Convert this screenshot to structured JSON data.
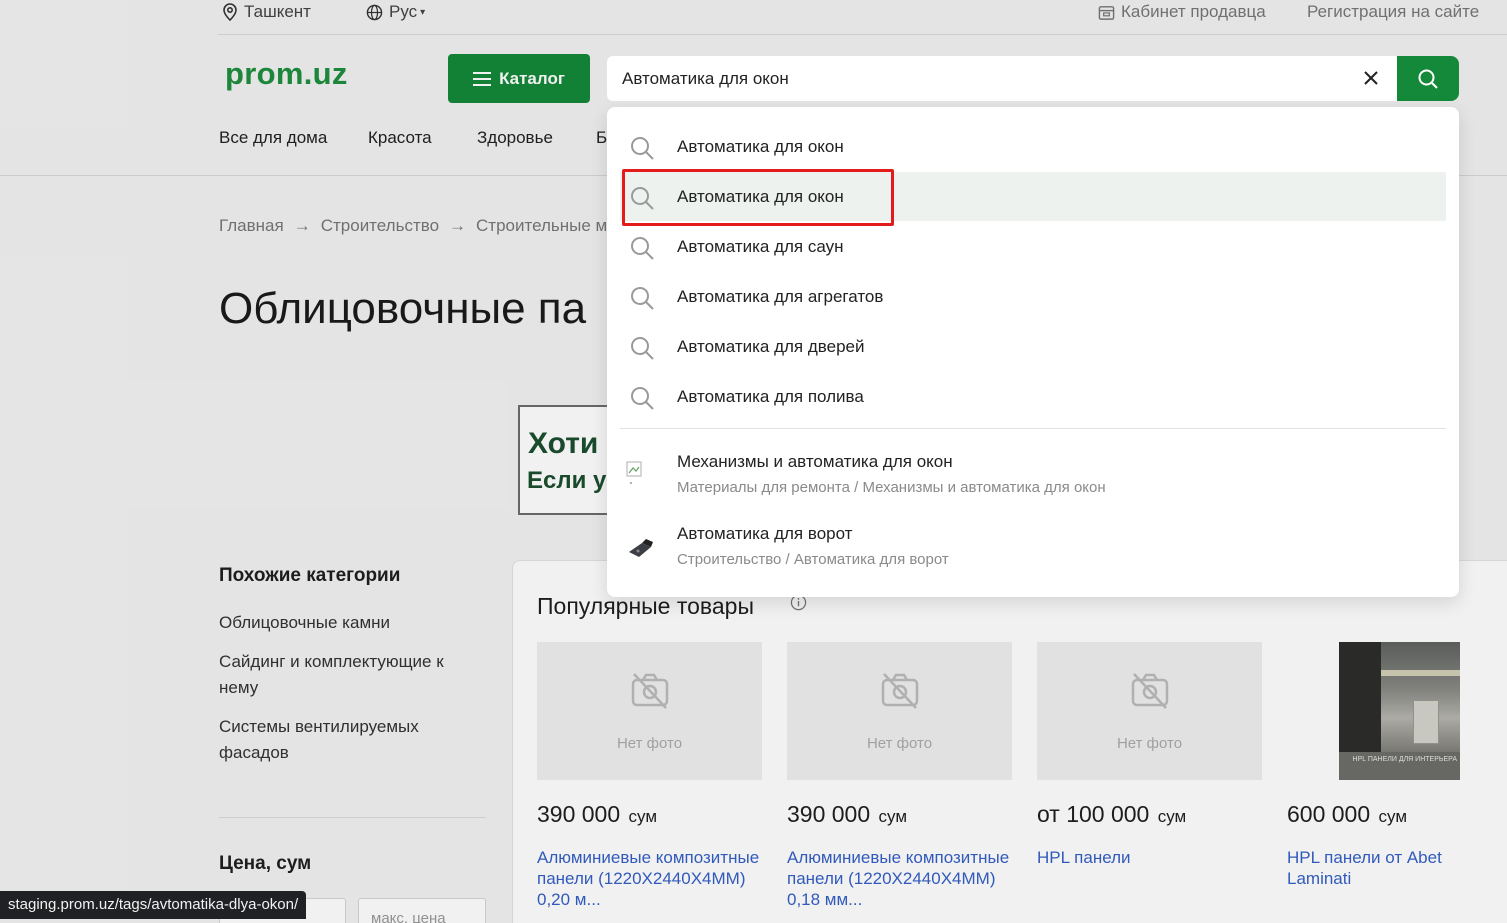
{
  "topbar": {
    "city": "Ташкент",
    "language": "Рус",
    "seller_cabinet": "Кабинет продавца",
    "register": "Регистрация на сайте"
  },
  "header": {
    "logo": "prom.uz",
    "catalog_label": "Каталог",
    "search_value": "Автоматика для окон",
    "nav": [
      "Все для дома",
      "Красота",
      "Здоровье",
      "Б"
    ]
  },
  "breadcrumb": {
    "items": [
      "Главная",
      "Строительство",
      "Строительные мат"
    ]
  },
  "page": {
    "title": "Облицовочные па",
    "banner_line1": "Хоти",
    "banner_line2": "Если у"
  },
  "sidebar": {
    "similar_title": "Похожие категории",
    "links": [
      "Облицовочные камни",
      "Сайдинг и комплектующие к нему",
      "Системы вентилируемых фасадов"
    ],
    "price_title": "Цена, сум",
    "price_max_placeholder": "макс. цена"
  },
  "popular": {
    "title": "Популярные товары",
    "no_photo": "Нет фото",
    "products": [
      {
        "price": "390 000",
        "currency": "сум",
        "name": "Алюминиевые композитные панели (1220X2440X4MM) 0,20 м..."
      },
      {
        "price": "390 000",
        "currency": "сум",
        "name": "Алюминиевые композитные панели (1220X2440X4MM) 0,18 мм..."
      },
      {
        "price": "от 100 000",
        "currency": "сум",
        "name": "HPL панели"
      },
      {
        "price": "600 000",
        "currency": "сум",
        "name": "HPL панели от Abet Laminati"
      }
    ],
    "photo_caption": "HPL ПАНЕЛИ ДЛЯ ИНТЕРЬЕРА"
  },
  "dropdown": {
    "suggestions": [
      "Автоматика для окон",
      "Автоматика для окон",
      "Автоматика для саун",
      "Автоматика для агрегатов",
      "Автоматика для дверей",
      "Автоматика для полива"
    ],
    "categories": [
      {
        "title": "Механизмы и автоматика для окон",
        "path": "Материалы для ремонта / Механизмы и автоматика для окон"
      },
      {
        "title": "Автоматика для ворот",
        "path": "Строительство / Автоматика для ворот"
      }
    ]
  },
  "status": {
    "url": "staging.prom.uz/tags/avtomatika-dlya-okon/"
  },
  "colors": {
    "brand_green": "#14893a",
    "link_blue": "#3560c7",
    "highlight_red": "#e41b1b"
  }
}
